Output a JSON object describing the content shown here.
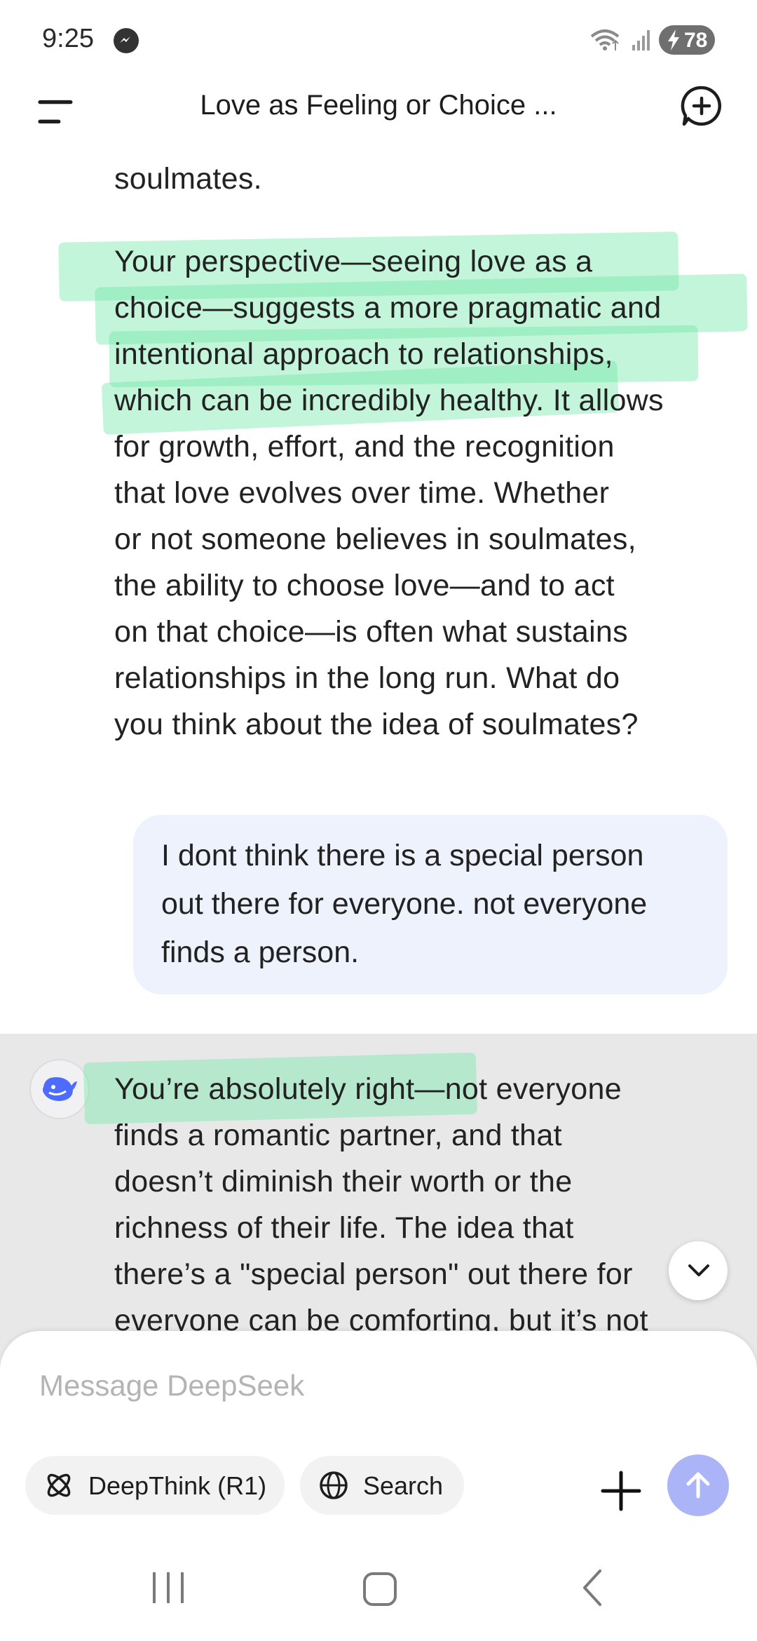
{
  "status_bar": {
    "time": "9:25",
    "battery": "78"
  },
  "header": {
    "title": "Love as Feeling or Choice ..."
  },
  "messages": {
    "ai_prev_partial": "soulmates.",
    "ai_prev_paragraph": [
      "Your perspective—seeing love as a",
      "choice—suggests a more pragmatic and",
      "intentional approach to relationships,",
      "which can be incredibly healthy. It allows",
      "for growth, effort, and the recognition",
      "that love evolves over time. Whether",
      "or not someone believes in soulmates,",
      "the ability to choose love—and to act",
      "on that choice—is often what sustains",
      "relationships in the long run. What do",
      "you think about the idea of soulmates?"
    ],
    "user_message": [
      "I dont think there is a special person",
      "out there for everyone. not everyone",
      "finds a person."
    ],
    "ai_reply": [
      "You’re absolutely right—not everyone",
      "finds a romantic partner, and that",
      "doesn’t diminish their worth or the",
      "richness of their life. The idea that",
      "there’s a \"special person\" out there for",
      "everyone can be comforting, but it’s not"
    ]
  },
  "composer": {
    "placeholder": "Message DeepSeek",
    "deepthink_label": "DeepThink (R1)",
    "search_label": "Search"
  },
  "colors": {
    "highlight": "#78e8aa",
    "user_bubble": "#eef2fd",
    "send_button": "#aab4f6",
    "selected_section": "#e8e8e8",
    "deepseek_blue": "#4d6bfe"
  }
}
